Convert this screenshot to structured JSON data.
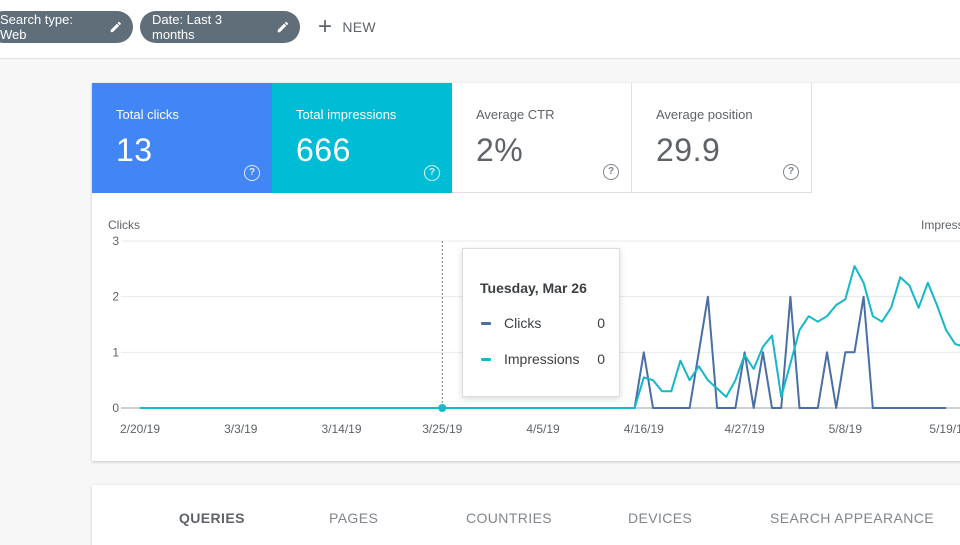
{
  "filters": {
    "search_type": "Search type: Web",
    "date": "Date: Last 3 months",
    "new_label": "NEW"
  },
  "metrics": [
    {
      "label": "Total clicks",
      "value": "13",
      "color": "#4285f4"
    },
    {
      "label": "Total impressions",
      "value": "666",
      "color": "#00bcd4"
    },
    {
      "label": "Average CTR",
      "value": "2%"
    },
    {
      "label": "Average position",
      "value": "29.9"
    }
  ],
  "help_glyph": "?",
  "chart_data": {
    "type": "line",
    "left_axis_label": "Clicks",
    "right_axis_label": "Impress",
    "y_ticks": [
      "3",
      "2",
      "1",
      "0"
    ],
    "ylim": [
      0,
      3
    ],
    "x_tick_labels": [
      "2/20/19",
      "3/3/19",
      "3/14/19",
      "3/25/19",
      "4/5/19",
      "4/16/19",
      "4/27/19",
      "5/8/19",
      "5/19/1"
    ],
    "x_start": "2019-02-20",
    "series": [
      {
        "name": "Clicks",
        "color": "#4a6fa5",
        "points": [
          [
            "2019-02-20",
            0
          ],
          [
            "2019-04-14",
            0
          ],
          [
            "2019-04-15",
            0
          ],
          [
            "2019-04-16",
            1
          ],
          [
            "2019-04-17",
            0
          ],
          [
            "2019-04-21",
            0
          ],
          [
            "2019-04-22",
            1
          ],
          [
            "2019-04-23",
            2
          ],
          [
            "2019-04-24",
            0
          ],
          [
            "2019-04-26",
            0
          ],
          [
            "2019-04-27",
            1
          ],
          [
            "2019-04-28",
            0
          ],
          [
            "2019-04-29",
            1
          ],
          [
            "2019-04-30",
            0
          ],
          [
            "2019-05-01",
            0
          ],
          [
            "2019-05-02",
            2
          ],
          [
            "2019-05-03",
            0
          ],
          [
            "2019-05-05",
            0
          ],
          [
            "2019-05-06",
            1
          ],
          [
            "2019-05-07",
            0
          ],
          [
            "2019-05-08",
            1
          ],
          [
            "2019-05-09",
            1
          ],
          [
            "2019-05-10",
            2
          ],
          [
            "2019-05-11",
            0
          ],
          [
            "2019-05-19",
            0
          ]
        ]
      },
      {
        "name": "Impressions",
        "color": "#14b8c8",
        "points": [
          [
            "2019-02-20",
            0
          ],
          [
            "2019-04-15",
            0
          ],
          [
            "2019-04-16",
            0.55
          ],
          [
            "2019-04-17",
            0.5
          ],
          [
            "2019-04-18",
            0.3
          ],
          [
            "2019-04-19",
            0.3
          ],
          [
            "2019-04-20",
            0.85
          ],
          [
            "2019-04-21",
            0.5
          ],
          [
            "2019-04-22",
            0.75
          ],
          [
            "2019-04-23",
            0.5
          ],
          [
            "2019-04-24",
            0.35
          ],
          [
            "2019-04-25",
            0.2
          ],
          [
            "2019-04-26",
            0.5
          ],
          [
            "2019-04-27",
            0.95
          ],
          [
            "2019-04-28",
            0.7
          ],
          [
            "2019-04-29",
            1.1
          ],
          [
            "2019-04-30",
            1.3
          ],
          [
            "2019-05-01",
            0.2
          ],
          [
            "2019-05-02",
            0.8
          ],
          [
            "2019-05-03",
            1.4
          ],
          [
            "2019-05-04",
            1.65
          ],
          [
            "2019-05-05",
            1.55
          ],
          [
            "2019-05-06",
            1.65
          ],
          [
            "2019-05-07",
            1.85
          ],
          [
            "2019-05-08",
            1.95
          ],
          [
            "2019-05-09",
            2.55
          ],
          [
            "2019-05-10",
            2.25
          ],
          [
            "2019-05-11",
            1.65
          ],
          [
            "2019-05-12",
            1.55
          ],
          [
            "2019-05-13",
            1.8
          ],
          [
            "2019-05-14",
            2.35
          ],
          [
            "2019-05-15",
            2.2
          ],
          [
            "2019-05-16",
            1.8
          ],
          [
            "2019-05-17",
            2.25
          ],
          [
            "2019-05-18",
            1.85
          ],
          [
            "2019-05-19",
            1.4
          ],
          [
            "2019-05-20",
            1.15
          ],
          [
            "2019-05-21",
            1.1
          ]
        ]
      }
    ],
    "hover_date": "2019-03-25"
  },
  "tooltip": {
    "date": "Tuesday, Mar 26",
    "rows": [
      {
        "name": "Clicks",
        "value": "0",
        "color": "#4a6fa5"
      },
      {
        "name": "Impressions",
        "value": "0",
        "color": "#14b8c8"
      }
    ]
  },
  "tabs": [
    {
      "label": "QUERIES",
      "active": true
    },
    {
      "label": "PAGES"
    },
    {
      "label": "COUNTRIES"
    },
    {
      "label": "DEVICES"
    },
    {
      "label": "SEARCH APPEARANCE"
    }
  ]
}
